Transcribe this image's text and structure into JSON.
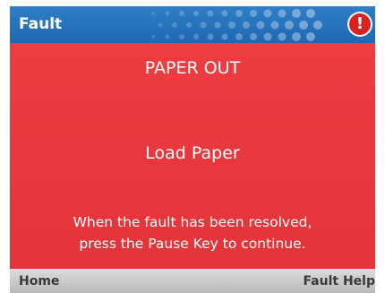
{
  "header": {
    "title": "Fault",
    "alert_icon": "exclamation-icon",
    "alert_glyph": "!"
  },
  "message": {
    "fault_name": "PAPER OUT",
    "instruction": "Load Paper",
    "note_line1": "When the fault has been resolved,",
    "note_line2": "press the Pause Key to continue."
  },
  "softkeys": {
    "left": "Home",
    "right": "Fault Help"
  },
  "colors": {
    "title_bar": "#2373b8",
    "fault_background": "#e8353a",
    "softkey_bar": "#c8c8c8"
  }
}
